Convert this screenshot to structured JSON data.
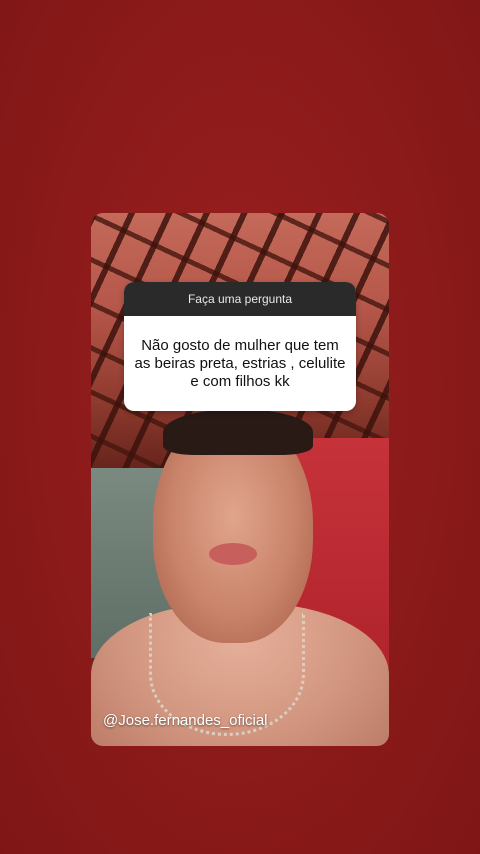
{
  "question_sticker": {
    "header": "Faça uma pergunta",
    "answer": "Não gosto de mulher que tem as beiras preta, estrias , celulite e com filhos kk"
  },
  "mention": {
    "text": "@Jose.fernandes_oficial"
  },
  "colors": {
    "background": "#8f1b1b",
    "sticker_header": "#2a2a2a",
    "sticker_body": "#ffffff"
  }
}
